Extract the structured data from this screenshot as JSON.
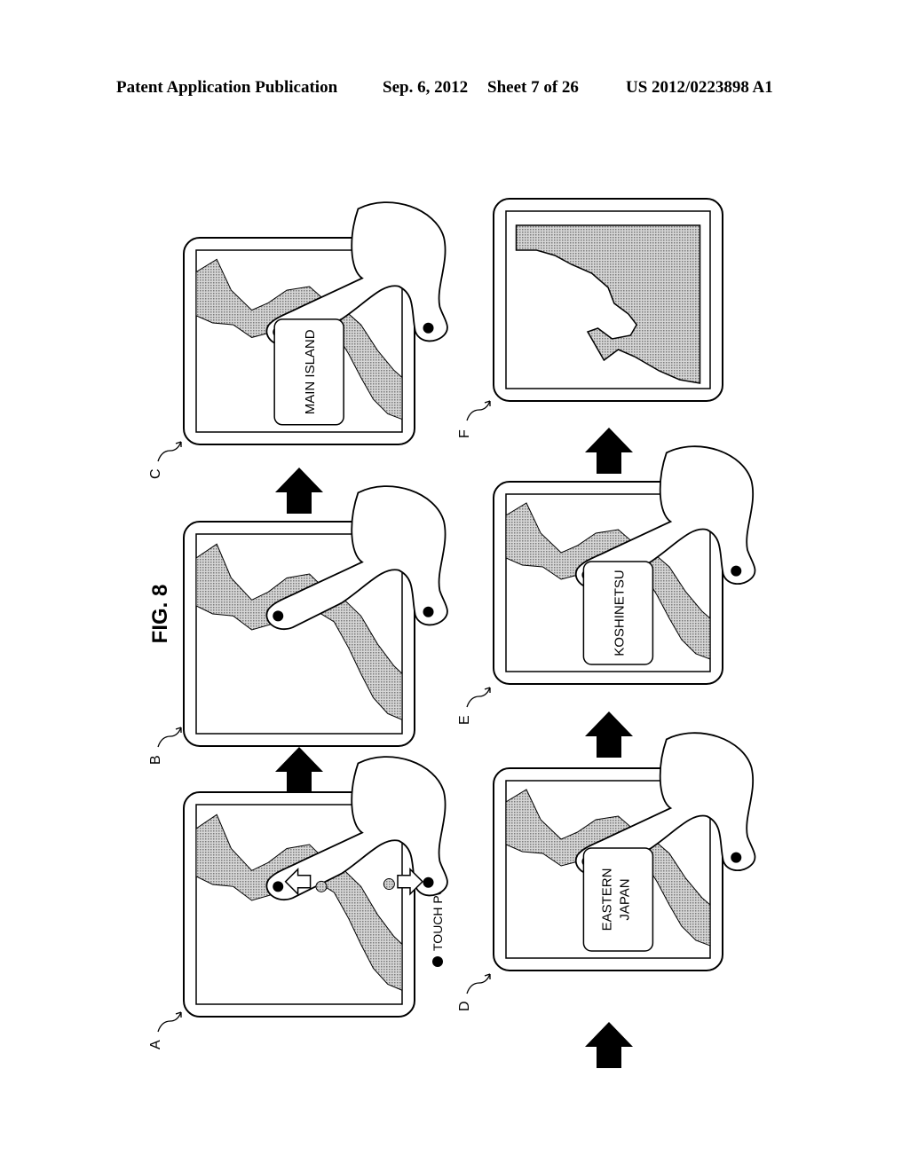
{
  "header": {
    "publication": "Patent Application Publication",
    "date": "Sep. 6, 2012",
    "sheet": "Sheet 7 of 26",
    "number": "US 2012/0223898 A1"
  },
  "figure": {
    "title": "FIG. 8",
    "legend": "TOUCH POINT",
    "orientation": "rotated 90° counter-clockwise",
    "panels": [
      {
        "id": "A",
        "label": "A",
        "popup": null,
        "state": "pinch-out with arrows, initial map"
      },
      {
        "id": "B",
        "label": "B",
        "popup": null,
        "state": "zoomed map, two touch points"
      },
      {
        "id": "C",
        "label": "C",
        "popup": "MAIN ISLAND",
        "state": "region name shown"
      },
      {
        "id": "D",
        "label": "D",
        "popup": "EASTERN JAPAN",
        "state": "region name shown"
      },
      {
        "id": "E",
        "label": "E",
        "popup": "KOSHINETSU",
        "state": "region name shown"
      },
      {
        "id": "F",
        "label": "F",
        "popup": null,
        "state": "fully zoomed coastline"
      }
    ]
  },
  "colors": {
    "ink": "#000000",
    "land_fill": "#b8b8b8",
    "paper": "#ffffff"
  }
}
